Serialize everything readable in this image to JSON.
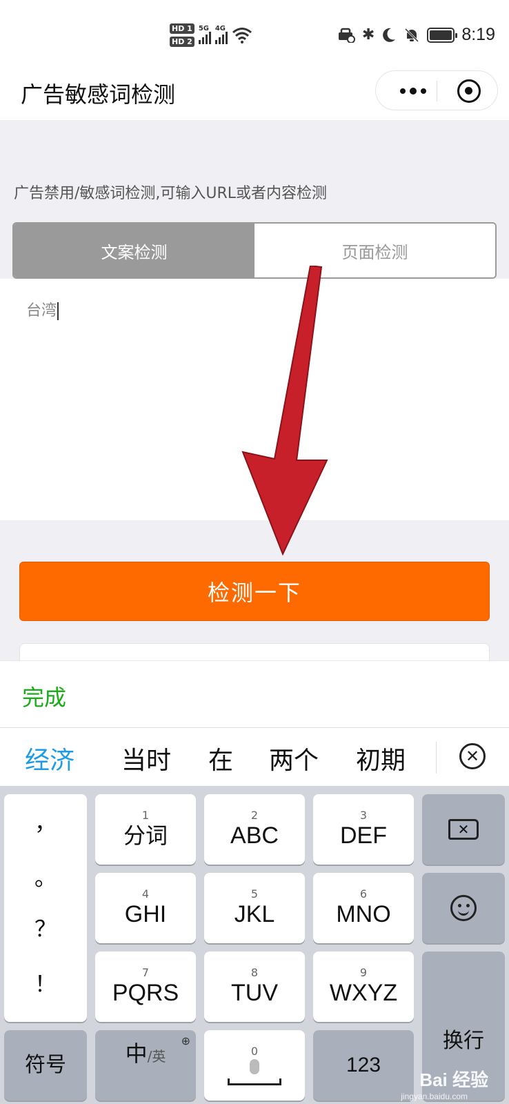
{
  "status_bar": {
    "hd1": "HD 1",
    "hd2": "HD 2",
    "net1": "5G",
    "net2": "4G",
    "time": "8:19"
  },
  "header": {
    "title": "广告敏感词检测"
  },
  "page": {
    "description": "广告禁用/敏感词检测,可输入URL或者内容检测",
    "tabs": [
      {
        "label": "文案检测",
        "active": true
      },
      {
        "label": "页面检测",
        "active": false
      }
    ],
    "input_value": "台湾",
    "check_button": "检测一下"
  },
  "done_bar": {
    "done_label": "完成"
  },
  "candidates": {
    "items": [
      "经济",
      "当时",
      "在",
      "两个",
      "初期"
    ],
    "highlight_color": "#1e9be6"
  },
  "keyboard": {
    "punctuation": [
      "，",
      "。",
      "？",
      "！"
    ],
    "keys": [
      {
        "num": "1",
        "label": "分词"
      },
      {
        "num": "2",
        "label": "ABC"
      },
      {
        "num": "3",
        "label": "DEF"
      },
      {
        "num": "4",
        "label": "GHI"
      },
      {
        "num": "5",
        "label": "JKL"
      },
      {
        "num": "6",
        "label": "MNO"
      },
      {
        "num": "7",
        "label": "PQRS"
      },
      {
        "num": "8",
        "label": "TUV"
      },
      {
        "num": "9",
        "label": "WXYZ"
      }
    ],
    "symbols_label": "符号",
    "lang_main": "中",
    "lang_sub": "/英",
    "space_num": "0",
    "numbers_label": "123",
    "enter_label": "换行"
  },
  "watermark": {
    "text": "Bai 经验",
    "sub": "jingyan.baidu.com"
  },
  "colors": {
    "accent": "#ff6a00",
    "done_green": "#1aad19",
    "tab_active": "#9a9a9a",
    "arrow_red": "#c8202a"
  }
}
